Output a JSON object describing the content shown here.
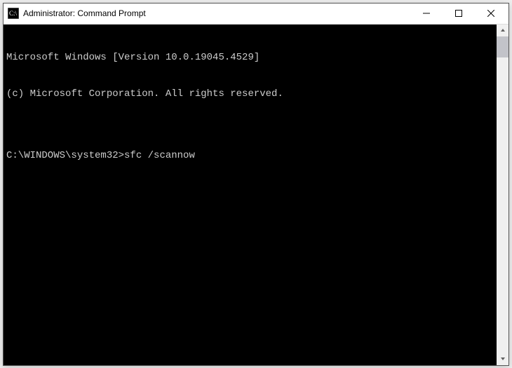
{
  "window": {
    "title": "Administrator: Command Prompt"
  },
  "console": {
    "line1": "Microsoft Windows [Version 10.0.19045.4529]",
    "line2": "(c) Microsoft Corporation. All rights reserved.",
    "blank": "",
    "prompt": "C:\\WINDOWS\\system32>",
    "command": "sfc /scannow"
  }
}
